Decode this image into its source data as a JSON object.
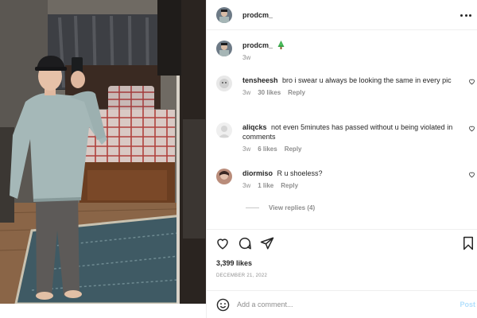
{
  "post": {
    "image_alt": "Mirror selfie",
    "author": "prodcm_"
  },
  "header": {
    "username": "prodcm_",
    "more_icon": "more-horizontal-icon"
  },
  "caption": {
    "username": "prodcm_",
    "emoji_icon": "christmas-tree-icon",
    "time": "3w"
  },
  "comments": [
    {
      "username": "tensheesh",
      "text": "bro i swear u always be looking the same in every pic",
      "time": "3w",
      "likes": "30 likes",
      "reply": "Reply"
    },
    {
      "username": "aliqcks",
      "text": "not even 5minutes has passed without u being violated in comments",
      "time": "3w",
      "likes": "6 likes",
      "reply": "Reply"
    },
    {
      "username": "diormiso",
      "text": "R u shoeless?",
      "time": "3w",
      "likes": "1 like",
      "reply": "Reply"
    }
  ],
  "view_replies": "View replies (4)",
  "actions": {
    "like_icon": "heart-icon",
    "comment_icon": "comment-icon",
    "share_icon": "send-icon",
    "save_icon": "bookmark-icon"
  },
  "likes": "3,399 likes",
  "date": "DECEMBER 21, 2022",
  "add_comment": {
    "placeholder": "Add a comment...",
    "value": "",
    "post_label": "Post"
  },
  "colors": {
    "text": "#262626",
    "secondary": "#8e8e8e",
    "post_button_disabled": "#b2dffc",
    "divider": "#efefef"
  }
}
